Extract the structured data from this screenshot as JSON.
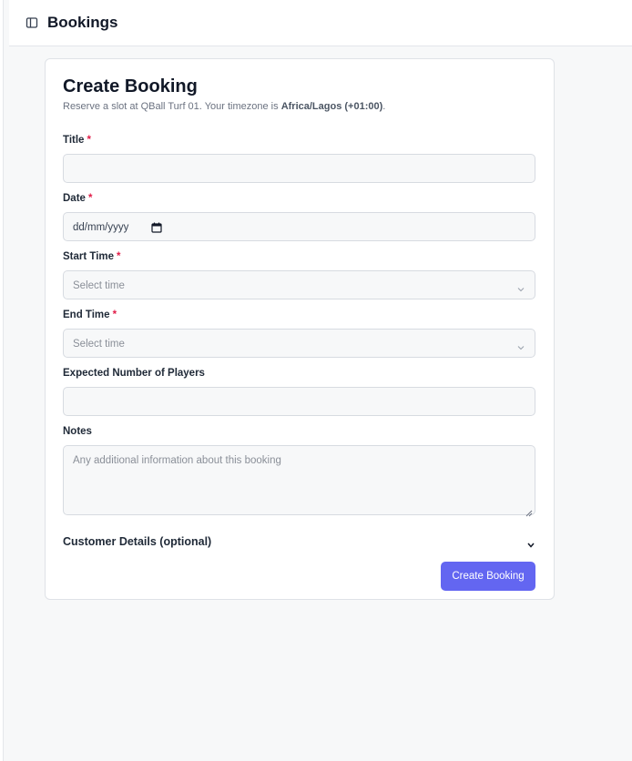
{
  "header": {
    "title": "Bookings",
    "toggle_icon": "sidebar-toggle-icon"
  },
  "form": {
    "title": "Create Booking",
    "subtitle_prefix": "Reserve a slot at QBall Turf 01. Your timezone is ",
    "subtitle_timezone": "Africa/Lagos (+01:00)",
    "subtitle_suffix": ".",
    "required_marker": "*",
    "fields": {
      "title": {
        "label": "Title",
        "value": ""
      },
      "date": {
        "label": "Date",
        "value": "dd/mm/yyyy"
      },
      "start_time": {
        "label": "Start Time",
        "placeholder": "Select time"
      },
      "end_time": {
        "label": "End Time",
        "placeholder": "Select time"
      },
      "players": {
        "label": "Expected Number of Players",
        "value": ""
      },
      "notes": {
        "label": "Notes",
        "placeholder": "Any additional information about this booking"
      }
    },
    "customer_details": {
      "label": "Customer Details (optional)"
    },
    "submit_label": "Create Booking"
  },
  "colors": {
    "accent": "#6366f1",
    "required": "#e11d48",
    "field_bg": "#f7f8f9",
    "border": "#d7dbe1"
  }
}
